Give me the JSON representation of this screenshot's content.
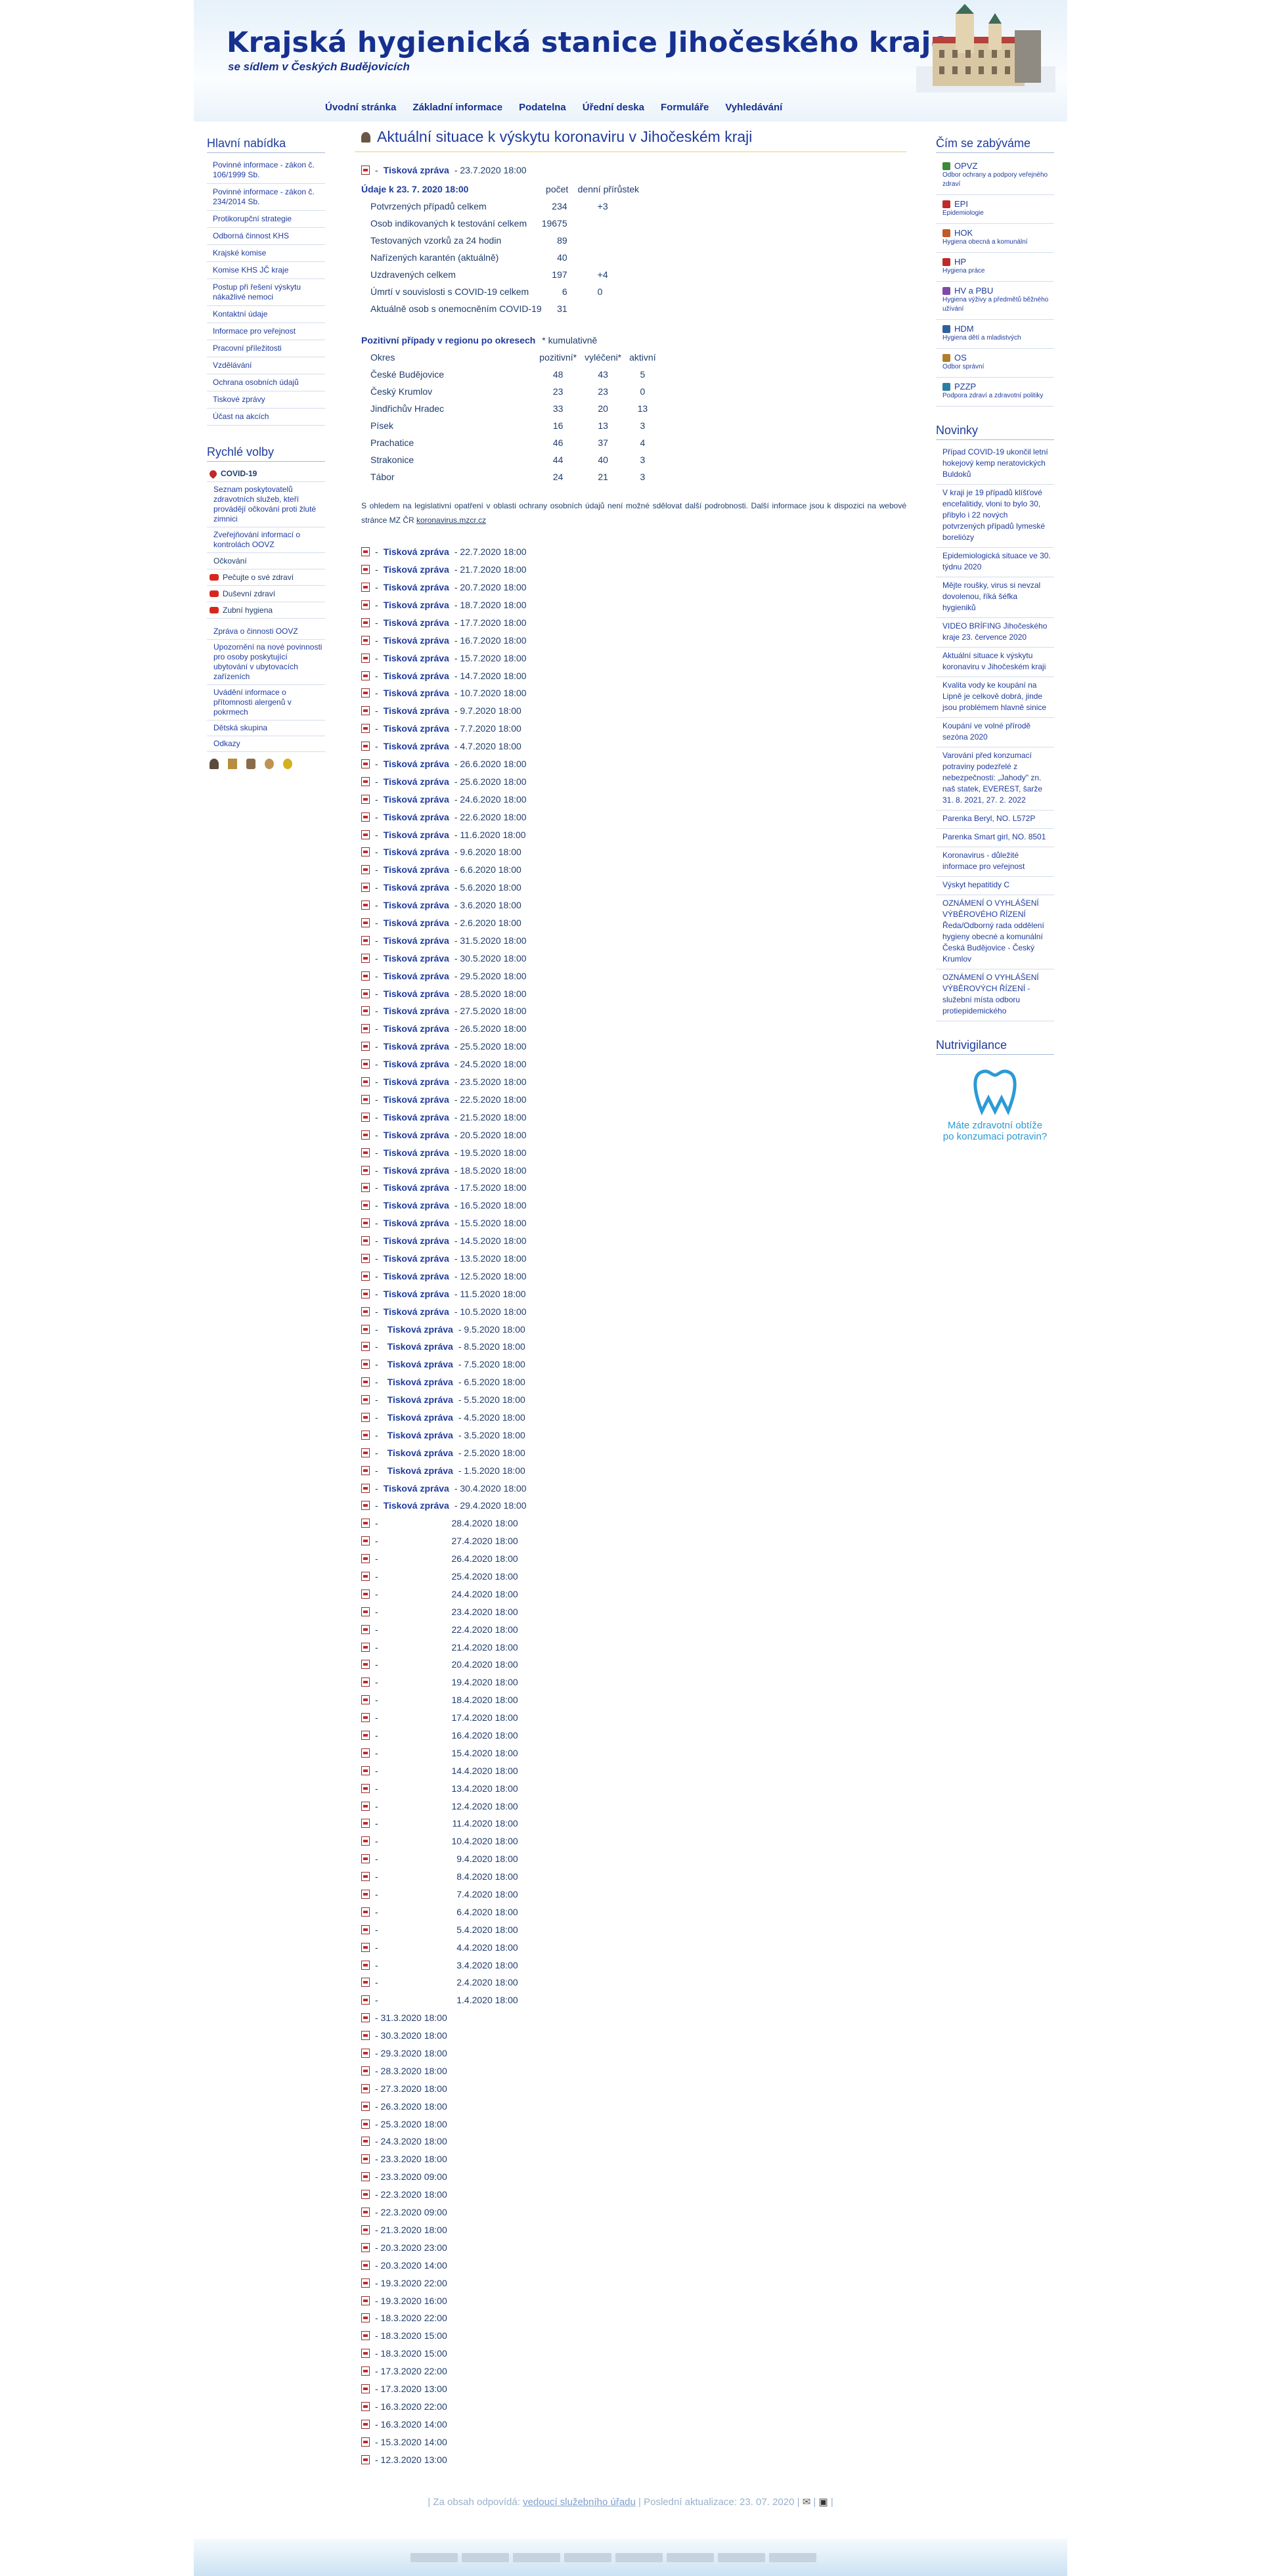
{
  "site": {
    "title": "Krajská hygienická stanice Jihočeského kraje",
    "subtitle": "se sídlem v Českých Budějovicích"
  },
  "topnav": [
    "Úvodní stránka",
    "Základní informace",
    "Podatelna",
    "Úřední deska",
    "Formuláře",
    "Vyhledávání"
  ],
  "left": {
    "main_title": "Hlavní nabídka",
    "main_items": [
      "Povinné informace - zákon č. 106/1999 Sb.",
      "Povinné informace - zákon č. 234/2014 Sb.",
      "Protikorupční strategie",
      "Odborná činnost KHS",
      "Krajské komise",
      "Komise KHS JČ kraje",
      "Postup při řešení výskytu nákažlivé nemoci",
      "Kontaktní údaje",
      "Informace pro veřejnost",
      "Pracovní příležitosti",
      "Vzdělávání",
      "Ochrana osobních údajů",
      "Tiskové zprávy",
      "Účast na akcích"
    ],
    "quick_title": "Rychlé volby",
    "quick_covid": "COVID-19",
    "quick_covid_sub": [
      "Seznam poskytovatelů zdravotních služeb, kteří provádějí očkování proti žluté zimnici",
      "Zveřejňování informací o kontrolách OOVZ"
    ],
    "quick_items": [
      "Očkování",
      "Pečujte o své zdraví",
      "Duševní zdraví",
      "Zubní hygiena"
    ],
    "quick_more": [
      "Zpráva o činnosti OOVZ",
      "Upozornění na nové povinnosti pro osoby poskytující ubytování v ubytovacích zařízeních",
      "Uvádění informace o přítomnosti alergenů v pokrmech",
      "Dětská skupina",
      "Odkazy"
    ]
  },
  "right": {
    "cat_title": "Čím se zabýváme",
    "cats": [
      {
        "name": "OPVZ",
        "desc": "Odbor ochrany a podpory veřejného zdraví"
      },
      {
        "name": "EPI",
        "desc": "Epidemiologie"
      },
      {
        "name": "HOK",
        "desc": "Hygiena obecná a komunální"
      },
      {
        "name": "HP",
        "desc": "Hygiena práce"
      },
      {
        "name": "HV a PBU",
        "desc": "Hygiena výživy a předmětů běžného užívání"
      },
      {
        "name": "HDM",
        "desc": "Hygiena dětí a mladistvých"
      },
      {
        "name": "OS",
        "desc": "Odbor správní"
      },
      {
        "name": "PZZP",
        "desc": "Podpora zdraví a zdravotní politiky"
      }
    ],
    "news_title": "Novinky",
    "news": [
      "Případ COVID-19 ukončil letní hokejový kemp neratovických Buldoků",
      "V kraji je 19 případů klíšťové encefalitidy, vloni to bylo 30, přibylo i 22 nových potvrzených případů lymeské boreliózy",
      "Epidemiologická situace ve 30. týdnu 2020",
      "Mějte roušky, virus si nevzal dovolenou, říká šéfka hygieniků",
      "VIDEO BRÍFING Jihočeského kraje 23. července 2020",
      "Aktuální situace k výskytu koronaviru v Jihočeském kraji",
      "Kvalita vody ke koupání na Lipně je celkově dobrá, jinde jsou problémem hlavně sinice",
      "Koupání ve volné přírodě sezóna 2020",
      "Varování před konzumací potraviny podezřelé z nebezpečnosti: „Jahody\" zn. naš statek, EVEREST, šarže 31. 8. 2021, 27. 2. 2022",
      "Parenka Beryl, NO. L572P",
      "Parenka Smart girl, NO. 8501",
      "Koronavirus - důležité informace pro veřejnost",
      "Výskyt hepatitidy C",
      "OZNÁMENÍ O VYHLÁŠENÍ VÝBĚROVÉHO ŘÍZENÍ Ředa/Odborný rada oddělení hygieny obecné a komunální Česká Budějovice - Český Krumlov",
      "OZNÁMENÍ O VYHLÁŠENÍ VÝBĚROVÝCH ŘÍZENÍ - služební místa odboru protiepidemického"
    ],
    "nutri_title": "Nutrivigilance",
    "nutri_text1": "Máte zdravotní obtíže",
    "nutri_text2": "po konzumaci potravin?"
  },
  "main": {
    "title": "Aktuální situace k výskytu koronaviru v Jihočeském kraji",
    "first_report": {
      "label": "Tisková zpráva",
      "date": "- 23.7.2020 18:00"
    },
    "data_header": "Údaje k 23. 7. 2020 18:00",
    "col_count": "počet",
    "col_daily": "denní přírůstek",
    "stats": [
      [
        "Potvrzených případů celkem",
        "234",
        "+3"
      ],
      [
        "Osob indikovaných k testování celkem",
        "19675",
        ""
      ],
      [
        "Testovaných vzorků za 24 hodin",
        "89",
        ""
      ],
      [
        "Nařízených karantén (aktuálně)",
        "40",
        ""
      ],
      [
        "Uzdravených celkem",
        "197",
        "+4"
      ],
      [
        "Úmrtí v souvislosti s COVID-19 celkem",
        "6",
        "0"
      ],
      [
        "Aktuálně osob s onemocněním COVID-19",
        "31",
        ""
      ]
    ],
    "region_title": "Pozitivní případy v regionu po okresech",
    "region_note": "* kumulativně",
    "region_cols": [
      "Okres",
      "pozitivní*",
      "vyléčeni*",
      "aktivní"
    ],
    "regions": [
      [
        "České Budějovice",
        "48",
        "43",
        "5"
      ],
      [
        "Český Krumlov",
        "23",
        "23",
        "0"
      ],
      [
        "Jindřichův Hradec",
        "33",
        "20",
        "13"
      ],
      [
        "Písek",
        "16",
        "13",
        "3"
      ],
      [
        "Prachatice",
        "46",
        "37",
        "4"
      ],
      [
        "Strakonice",
        "44",
        "40",
        "3"
      ],
      [
        "Tábor",
        "24",
        "21",
        "3"
      ]
    ],
    "note": "S ohledem na legislativní opatření v oblasti ochrany osobních údajů není možné sdělovat další podrobnosti. Další informace jsou k dispozici na webové stránce MZ ČR",
    "note_link": "koronavirus.mzcr.cz",
    "report_label": "Tisková zpráva",
    "reports": [
      "22.7.2020 18:00",
      "21.7.2020 18:00",
      "20.7.2020 18:00",
      "18.7.2020 18:00",
      "17.7.2020 18:00",
      "16.7.2020 18:00",
      "15.7.2020 18:00",
      "14.7.2020 18:00",
      "10.7.2020 18:00",
      "9.7.2020 18:00",
      "7.7.2020 18:00",
      "4.7.2020 18:00",
      "26.6.2020 18:00",
      "25.6.2020 18:00",
      "24.6.2020 18:00",
      "22.6.2020 18:00",
      "11.6.2020 18:00",
      "9.6.2020 18:00",
      "6.6.2020 18:00",
      "5.6.2020 18:00",
      "3.6.2020 18:00",
      "2.6.2020 18:00",
      "31.5.2020 18:00",
      "30.5.2020 18:00",
      "29.5.2020 18:00",
      "28.5.2020 18:00",
      "27.5.2020 18:00",
      "26.5.2020 18:00",
      "25.5.2020 18:00",
      "24.5.2020 18:00",
      "23.5.2020 18:00",
      "22.5.2020 18:00",
      "21.5.2020 18:00",
      "20.5.2020 18:00",
      "19.5.2020 18:00",
      "18.5.2020 18:00",
      "17.5.2020 18:00",
      "16.5.2020 18:00",
      "15.5.2020 18:00",
      "14.5.2020 18:00",
      "13.5.2020 18:00",
      "12.5.2020 18:00",
      "11.5.2020 18:00",
      "10.5.2020 18:00",
      "9.5.2020 18:00",
      "8.5.2020 18:00",
      "7.5.2020 18:00",
      "6.5.2020 18:00",
      "5.5.2020 18:00",
      "4.5.2020 18:00",
      "3.5.2020 18:00",
      "2.5.2020 18:00",
      "1.5.2020 18:00",
      "30.4.2020 18:00",
      "29.4.2020 18:00"
    ],
    "dates_only": [
      "28.4.2020 18:00",
      "27.4.2020 18:00",
      "26.4.2020 18:00",
      "25.4.2020 18:00",
      "24.4.2020 18:00",
      "23.4.2020 18:00",
      "22.4.2020 18:00",
      "21.4.2020 18:00",
      "20.4.2020 18:00",
      "19.4.2020 18:00",
      "18.4.2020 18:00",
      "17.4.2020 18:00",
      "16.4.2020 18:00",
      "15.4.2020 18:00",
      "14.4.2020 18:00",
      "13.4.2020 18:00",
      "12.4.2020 18:00",
      "11.4.2020 18:00",
      "10.4.2020 18:00",
      "9.4.2020 18:00",
      "8.4.2020 18:00",
      "7.4.2020 18:00",
      "6.4.2020 18:00",
      "5.4.2020 18:00",
      "4.4.2020 18:00",
      "3.4.2020 18:00",
      "2.4.2020 18:00",
      "1.4.2020 18:00"
    ],
    "march": [
      "31.3.2020 18:00",
      "30.3.2020 18:00",
      "29.3.2020 18:00",
      "28.3.2020 18:00",
      "27.3.2020 18:00",
      "26.3.2020 18:00",
      "25.3.2020 18:00",
      "24.3.2020 18:00",
      "23.3.2020 18:00",
      "23.3.2020 09:00",
      "22.3.2020 18:00",
      "22.3.2020 09:00",
      "21.3.2020 18:00",
      "20.3.2020 23:00",
      "20.3.2020 14:00",
      "19.3.2020 22:00",
      "19.3.2020 16:00",
      "18.3.2020 22:00",
      "18.3.2020 15:00",
      "18.3.2020 15:00",
      "17.3.2020 22:00",
      "17.3.2020 13:00",
      "16.3.2020 22:00",
      "16.3.2020 14:00",
      "15.3.2020 14:00",
      "12.3.2020 13:00"
    ]
  },
  "footer": {
    "text": "| Za obsah odpovídá:",
    "link": "vedoucí služebního úřadu",
    "updated": "| Poslední aktualizace: 23. 07. 2020 |"
  }
}
